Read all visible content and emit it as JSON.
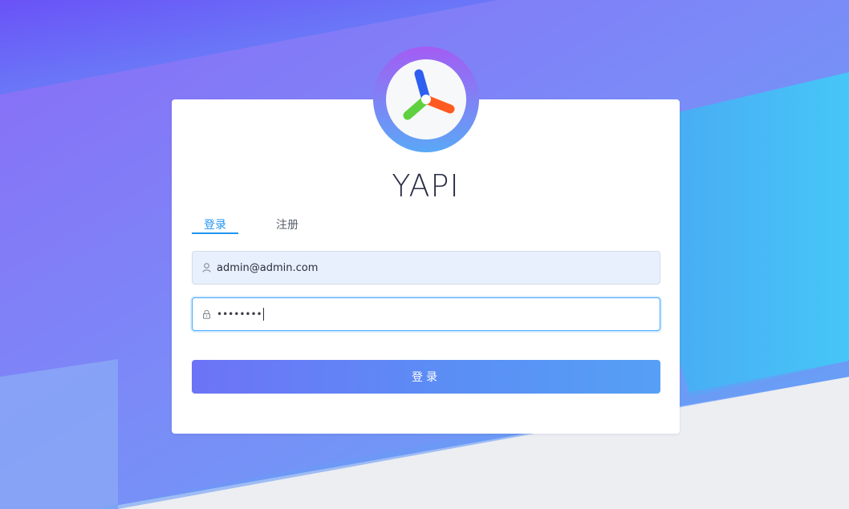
{
  "app": {
    "title": "YAPI"
  },
  "tabs": [
    {
      "label": "登录",
      "active": true
    },
    {
      "label": "注册",
      "active": false
    }
  ],
  "form": {
    "email": {
      "value": "admin@admin.com",
      "icon": "user-icon"
    },
    "password": {
      "masked_value": "••••••••",
      "icon": "lock-icon",
      "focused": true
    },
    "submit_label": "登录"
  },
  "colors": {
    "accent": "#2395f1",
    "button_gradient_start": "#6d73f6",
    "button_gradient_end": "#55a0f5",
    "logo_blue": "#2f5ff0",
    "logo_orange": "#ff5a1f",
    "logo_green": "#5fd13f"
  }
}
